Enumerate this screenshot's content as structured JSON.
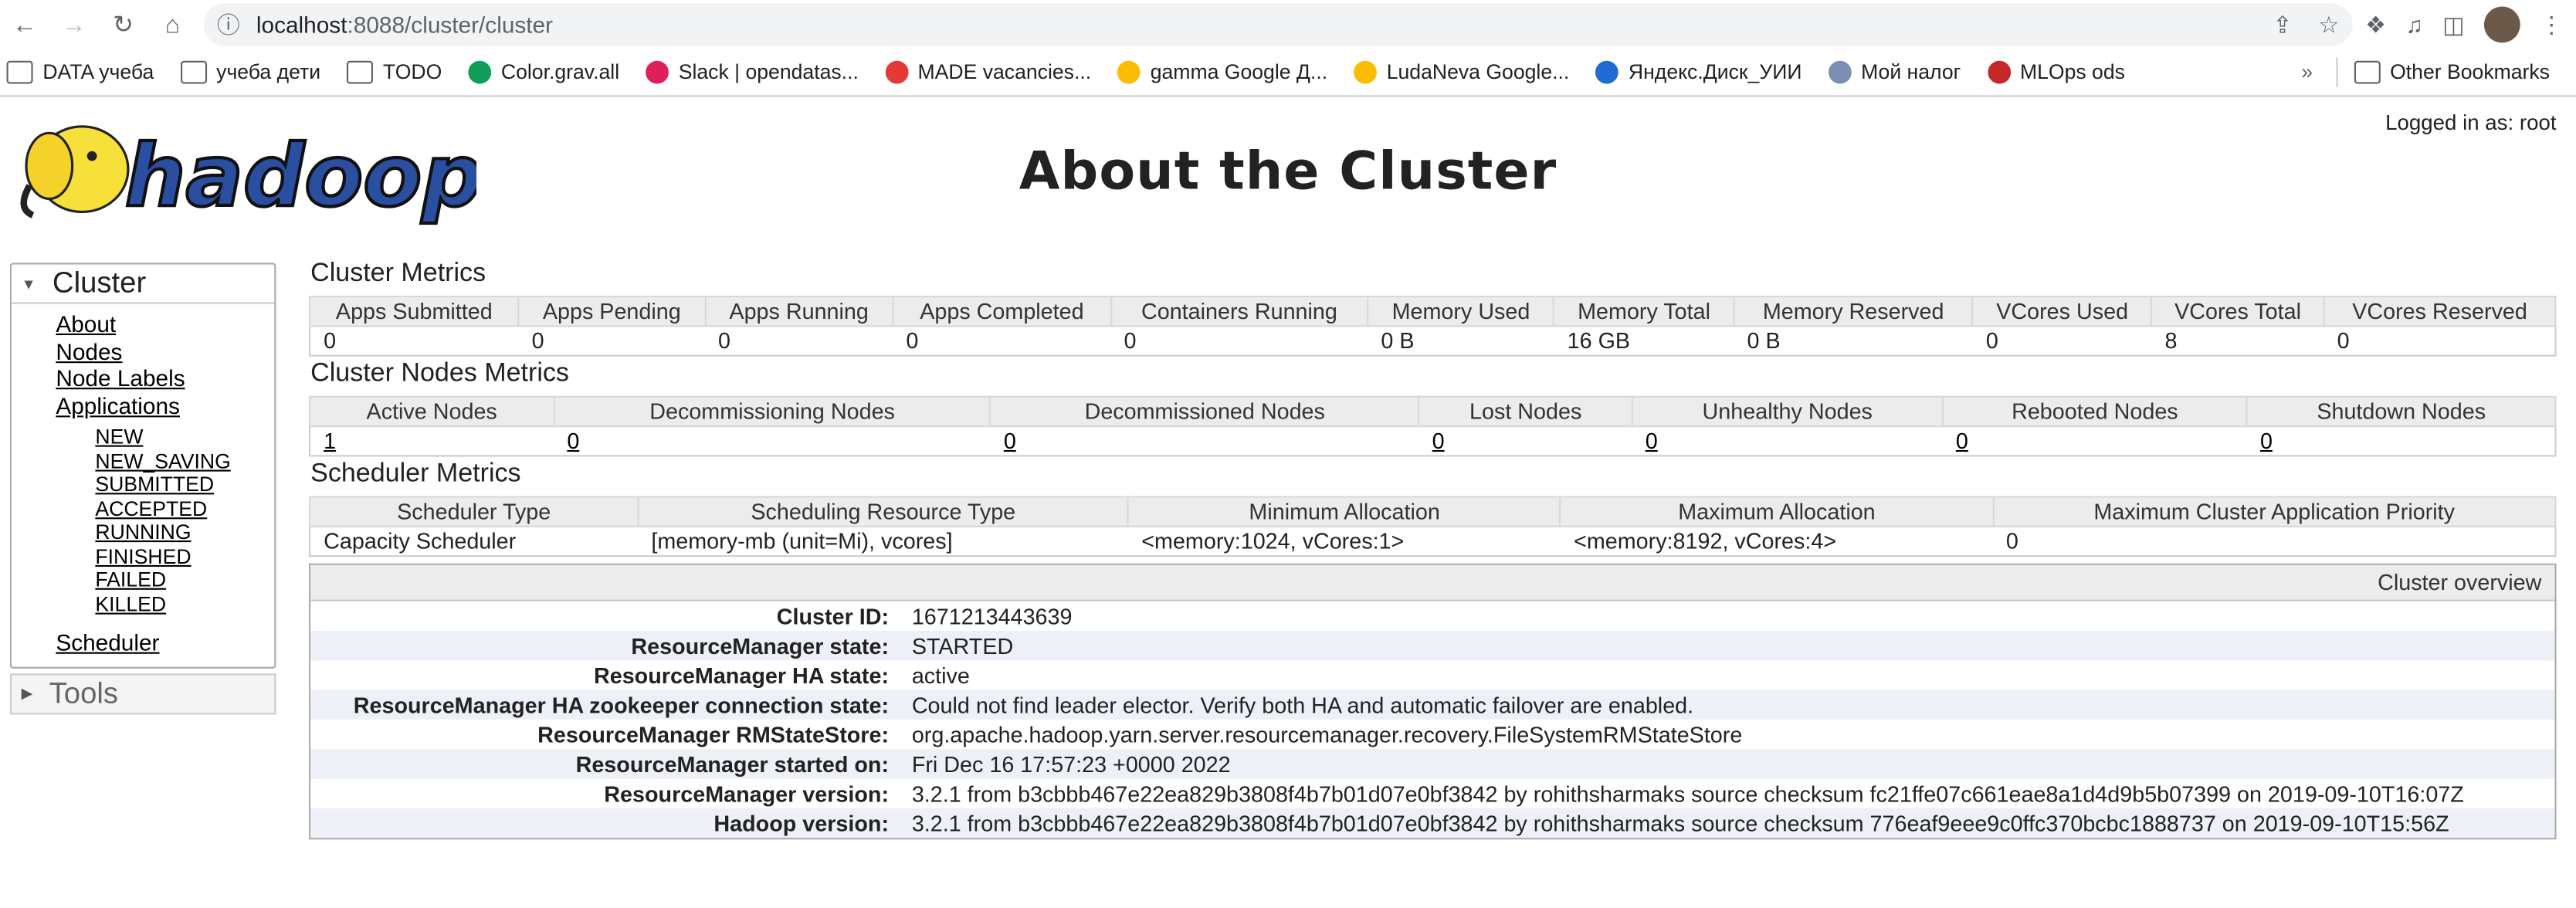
{
  "browser": {
    "url_host": "localhost",
    "url_path": ":8088/cluster/cluster",
    "bookmarks": [
      {
        "label": "DATA учеба",
        "icon": "folder-icon"
      },
      {
        "label": "учеба дети",
        "icon": "folder-icon"
      },
      {
        "label": "TODO",
        "icon": "folder-icon"
      },
      {
        "label": "Color.grav.all",
        "icon": "sheets-icon"
      },
      {
        "label": "Slack | opendatas...",
        "icon": "slack-icon"
      },
      {
        "label": "MADE vacancies...",
        "icon": "made-icon"
      },
      {
        "label": "gamma Google Д...",
        "icon": "drive-icon"
      },
      {
        "label": "LudaNeva Google...",
        "icon": "drive-icon"
      },
      {
        "label": "Яндекс.Диск_УИИ",
        "icon": "yandex-disk-icon"
      },
      {
        "label": "Мой налог",
        "icon": "tax-icon"
      },
      {
        "label": "MLOps ods",
        "icon": "ods-icon"
      }
    ],
    "more": "»",
    "other_bookmarks": "Other Bookmarks"
  },
  "page": {
    "title": "About the Cluster",
    "logged_in": "Logged in as: root"
  },
  "sidebar": {
    "cluster_label": "Cluster",
    "links": [
      "About",
      "Nodes",
      "Node Labels",
      "Applications"
    ],
    "app_states": [
      "NEW",
      "NEW_SAVING",
      "SUBMITTED",
      "ACCEPTED",
      "RUNNING",
      "FINISHED",
      "FAILED",
      "KILLED"
    ],
    "scheduler": "Scheduler",
    "tools_label": "Tools"
  },
  "cluster_metrics": {
    "title": "Cluster Metrics",
    "headers": [
      "Apps Submitted",
      "Apps Pending",
      "Apps Running",
      "Apps Completed",
      "Containers Running",
      "Memory Used",
      "Memory Total",
      "Memory Reserved",
      "VCores Used",
      "VCores Total",
      "VCores Reserved"
    ],
    "values": [
      "0",
      "0",
      "0",
      "0",
      "0",
      "0 B",
      "16 GB",
      "0 B",
      "0",
      "8",
      "0"
    ]
  },
  "node_metrics": {
    "title": "Cluster Nodes Metrics",
    "headers": [
      "Active Nodes",
      "Decommissioning Nodes",
      "Decommissioned Nodes",
      "Lost Nodes",
      "Unhealthy Nodes",
      "Rebooted Nodes",
      "Shutdown Nodes"
    ],
    "values": [
      "1",
      "0",
      "0",
      "0",
      "0",
      "0",
      "0"
    ]
  },
  "scheduler_metrics": {
    "title": "Scheduler Metrics",
    "headers": [
      "Scheduler Type",
      "Scheduling Resource Type",
      "Minimum Allocation",
      "Maximum Allocation",
      "Maximum Cluster Application Priority"
    ],
    "values": [
      "Capacity Scheduler",
      "[memory-mb (unit=Mi), vcores]",
      "<memory:1024, vCores:1>",
      "<memory:8192, vCores:4>",
      "0"
    ]
  },
  "overview": {
    "title": "Cluster overview",
    "rows": [
      {
        "label": "Cluster ID:",
        "value": "1671213443639"
      },
      {
        "label": "ResourceManager state:",
        "value": "STARTED"
      },
      {
        "label": "ResourceManager HA state:",
        "value": "active"
      },
      {
        "label": "ResourceManager HA zookeeper connection state:",
        "value": "Could not find leader elector. Verify both HA and automatic failover are enabled."
      },
      {
        "label": "ResourceManager RMStateStore:",
        "value": "org.apache.hadoop.yarn.server.resourcemanager.recovery.FileSystemRMStateStore"
      },
      {
        "label": "ResourceManager started on:",
        "value": "Fri Dec 16 17:57:23 +0000 2022"
      },
      {
        "label": "ResourceManager version:",
        "value": "3.2.1 from b3cbbb467e22ea829b3808f4b7b01d07e0bf3842 by rohithsharmaks source checksum fc21ffe07c661eae8a1d4d9b5b07399 on 2019-09-10T16:07Z"
      },
      {
        "label": "Hadoop version:",
        "value": "3.2.1 from b3cbbb467e22ea829b3808f4b7b01d07e0bf3842 by rohithsharmaks source checksum 776eaf9eee9c0ffc370bcbc1888737 on 2019-09-10T15:56Z"
      }
    ]
  },
  "logo_text": "hadoop"
}
